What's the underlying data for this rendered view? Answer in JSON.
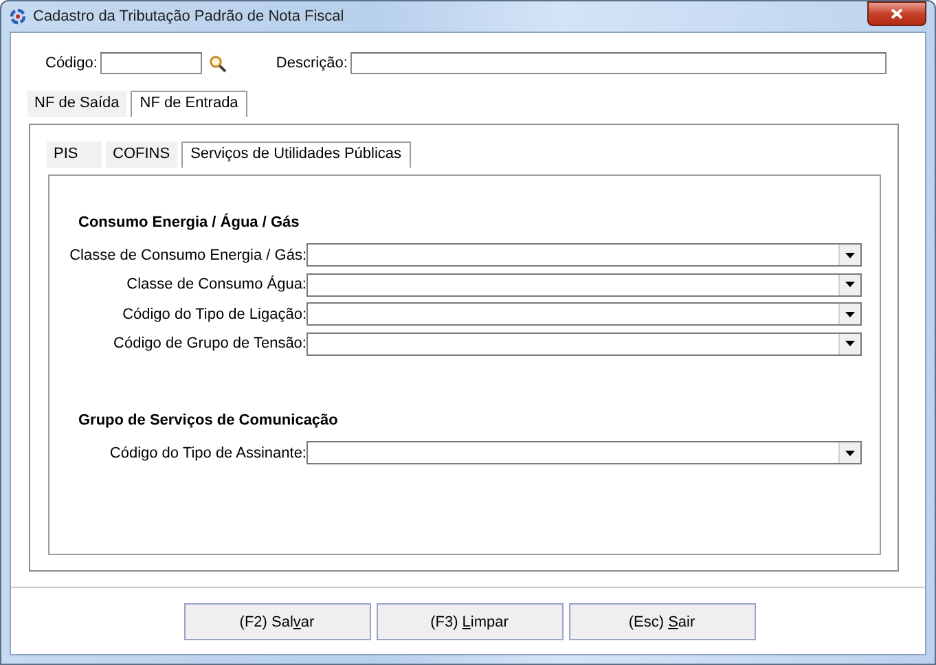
{
  "window": {
    "title": "Cadastro da Tributação Padrão de Nota Fiscal"
  },
  "header": {
    "code_label": "Código:",
    "description_label": "Descrição:"
  },
  "tabs": [
    {
      "label": "NF de Saída",
      "selected": false
    },
    {
      "label": "NF de Entrada",
      "selected": true
    }
  ],
  "subtabs": [
    {
      "label": "PIS",
      "selected": false
    },
    {
      "label": "COFINS",
      "selected": false
    },
    {
      "label": "Serviços de Utilidades Públicas",
      "selected": true
    }
  ],
  "sections": [
    {
      "heading": "Consumo Energia / Água / Gás",
      "fields": [
        {
          "label": "Classe de Consumo Energia / Gás:"
        },
        {
          "label": "Classe de Consumo Água:"
        },
        {
          "label": "Código do Tipo de Ligação:"
        },
        {
          "label": "Código de Grupo de Tensão:"
        }
      ]
    },
    {
      "heading": "Grupo de Serviços de Comunicação",
      "fields": [
        {
          "label": "Código do Tipo de Assinante:"
        }
      ]
    }
  ],
  "buttons": [
    {
      "label_parts": [
        "(F2) Sal",
        "v",
        "ar"
      ]
    },
    {
      "label_parts": [
        "(F3) ",
        "L",
        "impar"
      ]
    },
    {
      "label_parts": [
        "(Esc) ",
        "S",
        "air"
      ]
    }
  ]
}
